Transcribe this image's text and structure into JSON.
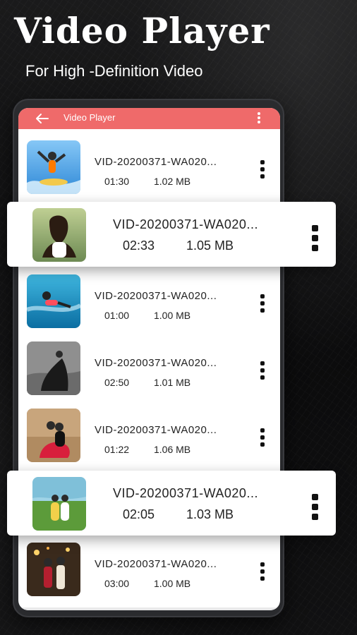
{
  "hero": {
    "title": "Video Player",
    "subtitle": "For High -Definition Video"
  },
  "appbar": {
    "title": "Video Player",
    "back_icon": "arrow-left-icon",
    "menu_icon": "more-vert-icon",
    "accent": "#ef6a6a"
  },
  "videos": [
    {
      "title": "VID-20200371-WA020...",
      "duration": "01:30",
      "size": "1.02 MB"
    },
    {
      "title": "VID-20200371-WA020...",
      "duration": "02:33",
      "size": "1.05 MB"
    },
    {
      "title": "VID-20200371-WA020...",
      "duration": "01:00",
      "size": "1.00 MB"
    },
    {
      "title": "VID-20200371-WA020...",
      "duration": "02:50",
      "size": "1.01 MB"
    },
    {
      "title": "VID-20200371-WA020...",
      "duration": "01:22",
      "size": "1.06 MB"
    },
    {
      "title": "VID-20200371-WA020...",
      "duration": "02:05",
      "size": "1.03 MB"
    },
    {
      "title": "VID-20200371-WA020...",
      "duration": "03:00",
      "size": "1.00 MB"
    }
  ]
}
